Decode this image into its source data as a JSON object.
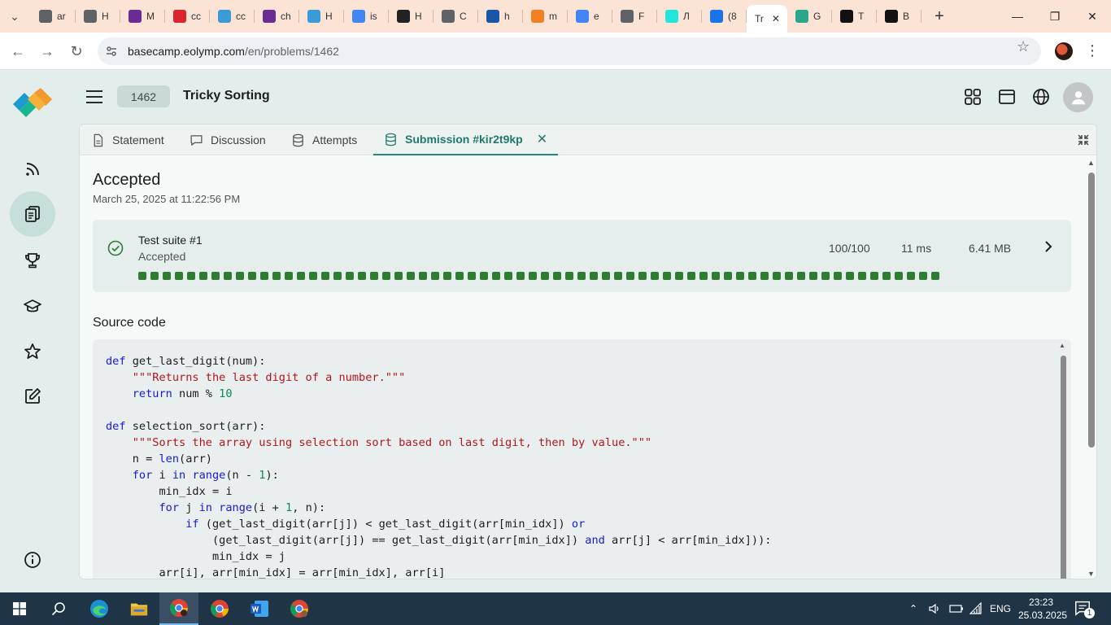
{
  "browser": {
    "tabs": [
      {
        "label": "ar",
        "icon": "chrome-globe-icon",
        "color": "#5f6368"
      },
      {
        "label": "H",
        "icon": "chrome-globe-icon",
        "color": "#5f6368"
      },
      {
        "label": "M",
        "icon": "wiki-w-icon",
        "color": "#6b2c91"
      },
      {
        "label": "cc",
        "icon": "red-flower-icon",
        "color": "#d9252b"
      },
      {
        "label": "cc",
        "icon": "blue-graph-icon",
        "color": "#3a9bd6"
      },
      {
        "label": "ch",
        "icon": "wiki-w-icon",
        "color": "#6b2c91"
      },
      {
        "label": "H",
        "icon": "blue-graph-icon",
        "color": "#3a9bd6"
      },
      {
        "label": "is",
        "icon": "google-icon",
        "color": "#4285f4"
      },
      {
        "label": "H",
        "icon": "wikipedia-icon",
        "color": "#222222"
      },
      {
        "label": "C",
        "icon": "chrome-globe-icon",
        "color": "#5f6368"
      },
      {
        "label": "h",
        "icon": "exclamation-box-icon",
        "color": "#1a56a8"
      },
      {
        "label": "m",
        "icon": "stackoverflow-icon",
        "color": "#f48024"
      },
      {
        "label": "e",
        "icon": "google-icon",
        "color": "#4285f4"
      },
      {
        "label": "F",
        "icon": "chrome-globe-icon",
        "color": "#5f6368"
      },
      {
        "label": "Л",
        "icon": "olx-icon",
        "color": "#23e5db"
      },
      {
        "label": "(8",
        "icon": "contact-card-icon",
        "color": "#1a73e8"
      },
      {
        "label": "Tr",
        "icon": "",
        "color": "#ffffff",
        "active": true
      },
      {
        "label": "G",
        "icon": "eolymp-icon",
        "color": "#2ca58d"
      },
      {
        "label": "T",
        "icon": "github-icon",
        "color": "#111111"
      },
      {
        "label": "B",
        "icon": "openai-icon",
        "color": "#111111"
      }
    ],
    "url_host": "basecamp.eolymp.com",
    "url_path": "/en/problems/1462"
  },
  "app": {
    "problem_id": "1462",
    "problem_title": "Tricky Sorting",
    "tabs": [
      {
        "label": "Statement"
      },
      {
        "label": "Discussion"
      },
      {
        "label": "Attempts"
      },
      {
        "label": "Submission #kir2t9kp",
        "active": true
      }
    ],
    "verdict": "Accepted",
    "date": "March 25, 2025 at 11:22:56 PM",
    "suite": {
      "name": "Test suite #1",
      "status": "Accepted",
      "score": "100/100",
      "time": "11 ms",
      "memory": "6.41 MB",
      "tests_passed": 66,
      "test_color": "#2e7d32"
    },
    "source_label": "Source code",
    "accent": "#1f8a79"
  },
  "taskbar": {
    "language": "ENG",
    "time": "23:23",
    "date": "25.03.2025",
    "notifications": "1"
  }
}
